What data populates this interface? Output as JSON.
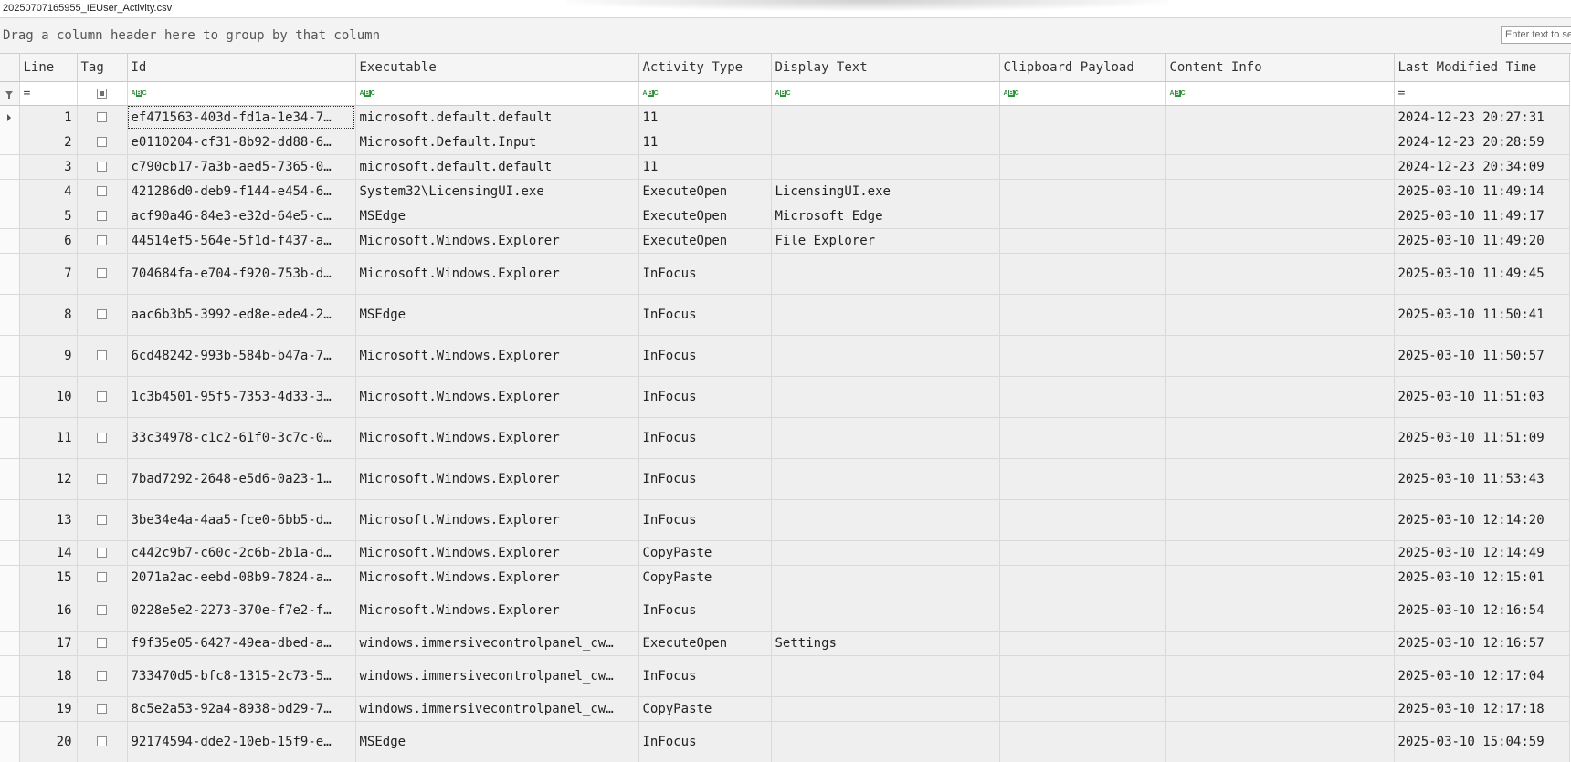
{
  "window": {
    "title": "20250707165955_IEUser_Activity.csv"
  },
  "group_bar": {
    "hint": "Drag a column header here to group by that column",
    "search_placeholder": "Enter text to search..."
  },
  "columns": [
    {
      "label": "Line"
    },
    {
      "label": "Tag"
    },
    {
      "label": "Id"
    },
    {
      "label": "Executable"
    },
    {
      "label": "Activity Type"
    },
    {
      "label": "Display Text"
    },
    {
      "label": "Clipboard Payload"
    },
    {
      "label": "Content Info"
    },
    {
      "label": "Last Modified Time"
    }
  ],
  "filter_row": {
    "line_op": "=",
    "lastmod_op": "=",
    "text_filter_icon": "abc-filter-icon"
  },
  "rows": [
    {
      "line": "1",
      "id": "ef471563-403d-fd1a-1e34-7…",
      "exe": "microsoft.default.default",
      "type": "11",
      "display": "",
      "clip": "",
      "content": "",
      "modified": "2024-12-23 20:27:31"
    },
    {
      "line": "2",
      "id": "e0110204-cf31-8b92-dd88-6…",
      "exe": "Microsoft.Default.Input",
      "type": "11",
      "display": "",
      "clip": "",
      "content": "",
      "modified": "2024-12-23 20:28:59"
    },
    {
      "line": "3",
      "id": "c790cb17-7a3b-aed5-7365-0…",
      "exe": "microsoft.default.default",
      "type": "11",
      "display": "",
      "clip": "",
      "content": "",
      "modified": "2024-12-23 20:34:09"
    },
    {
      "line": "4",
      "id": "421286d0-deb9-f144-e454-6…",
      "exe": "System32\\LicensingUI.exe",
      "type": "ExecuteOpen",
      "display": "LicensingUI.exe",
      "clip": "",
      "content": "",
      "modified": "2025-03-10 11:49:14"
    },
    {
      "line": "5",
      "id": "acf90a46-84e3-e32d-64e5-c…",
      "exe": "MSEdge",
      "type": "ExecuteOpen",
      "display": "Microsoft Edge",
      "clip": "",
      "content": "",
      "modified": "2025-03-10 11:49:17"
    },
    {
      "line": "6",
      "id": "44514ef5-564e-5f1d-f437-a…",
      "exe": "Microsoft.Windows.Explorer",
      "type": "ExecuteOpen",
      "display": "File Explorer",
      "clip": "",
      "content": "",
      "modified": "2025-03-10 11:49:20"
    },
    {
      "line": "7",
      "id": "704684fa-e704-f920-753b-d…",
      "exe": "Microsoft.Windows.Explorer",
      "type": "InFocus",
      "display": "",
      "clip": "",
      "content": "",
      "modified": "2025-03-10 11:49:45"
    },
    {
      "line": "8",
      "id": "aac6b3b5-3992-ed8e-ede4-2…",
      "exe": "MSEdge",
      "type": "InFocus",
      "display": "",
      "clip": "",
      "content": "",
      "modified": "2025-03-10 11:50:41"
    },
    {
      "line": "9",
      "id": "6cd48242-993b-584b-b47a-7…",
      "exe": "Microsoft.Windows.Explorer",
      "type": "InFocus",
      "display": "",
      "clip": "",
      "content": "",
      "modified": "2025-03-10 11:50:57"
    },
    {
      "line": "10",
      "id": "1c3b4501-95f5-7353-4d33-3…",
      "exe": "Microsoft.Windows.Explorer",
      "type": "InFocus",
      "display": "",
      "clip": "",
      "content": "",
      "modified": "2025-03-10 11:51:03"
    },
    {
      "line": "11",
      "id": "33c34978-c1c2-61f0-3c7c-0…",
      "exe": "Microsoft.Windows.Explorer",
      "type": "InFocus",
      "display": "",
      "clip": "",
      "content": "",
      "modified": "2025-03-10 11:51:09"
    },
    {
      "line": "12",
      "id": "7bad7292-2648-e5d6-0a23-1…",
      "exe": "Microsoft.Windows.Explorer",
      "type": "InFocus",
      "display": "",
      "clip": "",
      "content": "",
      "modified": "2025-03-10 11:53:43"
    },
    {
      "line": "13",
      "id": "3be34e4a-4aa5-fce0-6bb5-d…",
      "exe": "Microsoft.Windows.Explorer",
      "type": "InFocus",
      "display": "",
      "clip": "",
      "content": "",
      "modified": "2025-03-10 12:14:20"
    },
    {
      "line": "14",
      "id": "c442c9b7-c60c-2c6b-2b1a-d…",
      "exe": "Microsoft.Windows.Explorer",
      "type": "CopyPaste",
      "display": "",
      "clip": "",
      "content": "",
      "modified": "2025-03-10 12:14:49"
    },
    {
      "line": "15",
      "id": "2071a2ac-eebd-08b9-7824-a…",
      "exe": "Microsoft.Windows.Explorer",
      "type": "CopyPaste",
      "display": "",
      "clip": "",
      "content": "",
      "modified": "2025-03-10 12:15:01"
    },
    {
      "line": "16",
      "id": "0228e5e2-2273-370e-f7e2-f…",
      "exe": "Microsoft.Windows.Explorer",
      "type": "InFocus",
      "display": "",
      "clip": "",
      "content": "",
      "modified": "2025-03-10 12:16:54"
    },
    {
      "line": "17",
      "id": "f9f35e05-6427-49ea-dbed-a…",
      "exe": "windows.immersivecontrolpanel_cw…",
      "type": "ExecuteOpen",
      "display": "Settings",
      "clip": "",
      "content": "",
      "modified": "2025-03-10 12:16:57"
    },
    {
      "line": "18",
      "id": "733470d5-bfc8-1315-2c73-5…",
      "exe": "windows.immersivecontrolpanel_cw…",
      "type": "InFocus",
      "display": "",
      "clip": "",
      "content": "",
      "modified": "2025-03-10 12:17:04"
    },
    {
      "line": "19",
      "id": "8c5e2a53-92a4-8938-bd29-7…",
      "exe": "windows.immersivecontrolpanel_cw…",
      "type": "CopyPaste",
      "display": "",
      "clip": "",
      "content": "",
      "modified": "2025-03-10 12:17:18"
    },
    {
      "line": "20",
      "id": "92174594-dde2-10eb-15f9-e…",
      "exe": "MSEdge",
      "type": "InFocus",
      "display": "",
      "clip": "",
      "content": "",
      "modified": "2025-03-10 15:04:59"
    }
  ]
}
